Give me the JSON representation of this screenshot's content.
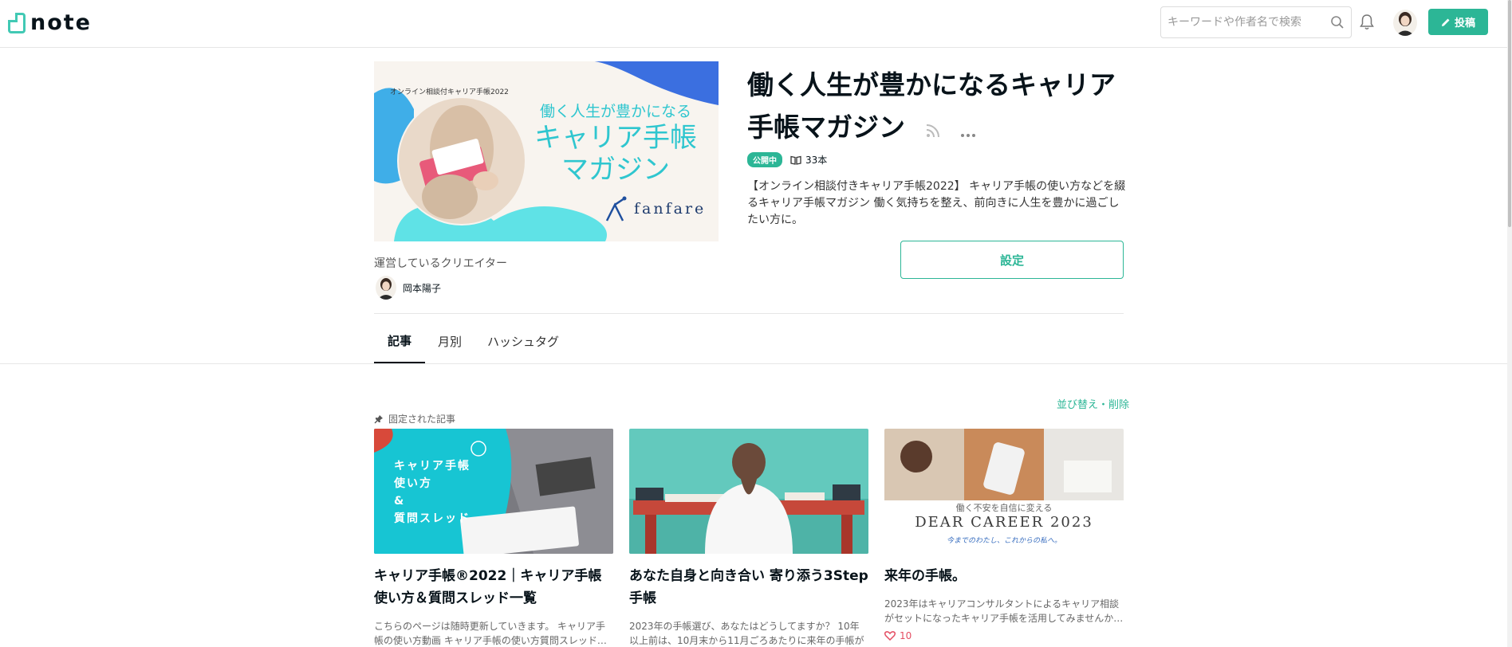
{
  "header": {
    "logo_text": "note",
    "search_placeholder": "キーワードや作者名で検索",
    "post_button": "投稿"
  },
  "magazine": {
    "cover": {
      "small_caption": "オンライン相談付キャリア手帳2022",
      "line1": "働く人生が豊かになる",
      "line2": "キャリア手帳",
      "line3": "マガジン",
      "brand": "fanfare"
    },
    "title": "働く人生が豊かになるキャリア手帳マガジン",
    "status_badge": "公開中",
    "article_count": "33本",
    "description": "【オンライン相談付きキャリア手帳2022】 キャリア手帳の使い方などを綴るキャリア手帳マガジン 働く気持ちを整え、前向きに人生を豊かに過ごしたい方に。",
    "settings_button": "設定",
    "creator_label": "運営しているクリエイター",
    "creator_name": "岡本陽子"
  },
  "tabs": [
    {
      "label": "記事",
      "active": true
    },
    {
      "label": "月別",
      "active": false
    },
    {
      "label": "ハッシュタグ",
      "active": false
    }
  ],
  "content": {
    "sort_link": "並び替え・削除",
    "pinned_label": "固定された記事",
    "cards": [
      {
        "image_text": "キャリア手帳 使い方 & 質問スレッド",
        "image_text_lines": [
          "キャリア手帳",
          "使い方",
          "&",
          "質問スレッド"
        ],
        "title": "キャリア手帳®2022｜キャリア手帳使い方＆質問スレッド一覧",
        "excerpt": "こちらのページは随時更新していきます。 キャリア手帳の使い方動画 キャリア手帳の使い方質問スレッド…",
        "likes": ""
      },
      {
        "image_text": "",
        "title": "あなた自身と向き合い 寄り添う3Step手帳",
        "excerpt": "2023年の手帳選び、あなたはどうしてますか？ 10年以上前は、10月末から11月ごろあたりに来年の手帳が書…",
        "likes": ""
      },
      {
        "image_caption_top": "働く不安を自信に変える",
        "image_caption_main": "DEAR CAREER 2023",
        "image_caption_script": "今までのわたし、これからの私へ。",
        "title": "来年の手帳。",
        "excerpt": "2023年はキャリアコンサルタントによるキャリア相談がセットになったキャリア手帳を活用してみませんか…",
        "likes": "10"
      }
    ]
  },
  "colors": {
    "accent": "#2cb696",
    "like": "#e44d62",
    "cover_teal": "#2fc6cf",
    "cover_blue": "#3b6fe0"
  }
}
